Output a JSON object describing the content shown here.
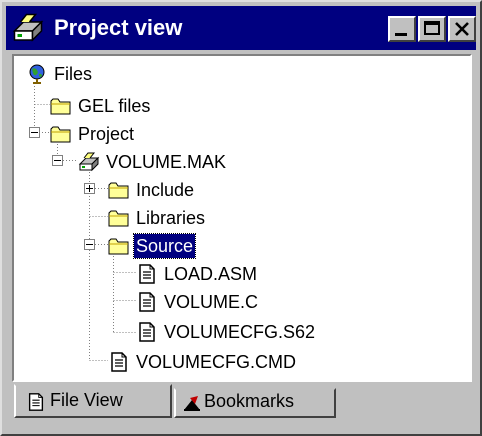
{
  "window": {
    "title": "Project view"
  },
  "tree": {
    "nodes": [
      {
        "label": "Files",
        "icon": "globe-icon"
      },
      {
        "label": "GEL files",
        "icon": "folder-icon"
      },
      {
        "label": "Project",
        "icon": "folder-icon",
        "expander": "expanded"
      },
      {
        "label": "VOLUME.MAK",
        "icon": "project-icon",
        "expander": "expanded"
      },
      {
        "label": "Include",
        "icon": "folder-icon",
        "expander": "collapsed"
      },
      {
        "label": "Libraries",
        "icon": "folder-icon"
      },
      {
        "label": "Source",
        "icon": "folder-icon",
        "expander": "expanded",
        "selected": true
      },
      {
        "label": "LOAD.ASM",
        "icon": "file-icon"
      },
      {
        "label": "VOLUME.C",
        "icon": "file-icon"
      },
      {
        "label": "VOLUMECFG.S62",
        "icon": "file-icon"
      },
      {
        "label": "VOLUMECFG.CMD",
        "icon": "file-icon"
      }
    ]
  },
  "tabs": [
    {
      "label": "File View",
      "icon": "file-icon",
      "active": true
    },
    {
      "label": "Bookmarks",
      "icon": "bookmark-icon",
      "active": false
    }
  ],
  "colors": {
    "titlebar": "#000080",
    "selection": "#000080",
    "face": "#c0c0c0",
    "folder": "#ffff80"
  }
}
